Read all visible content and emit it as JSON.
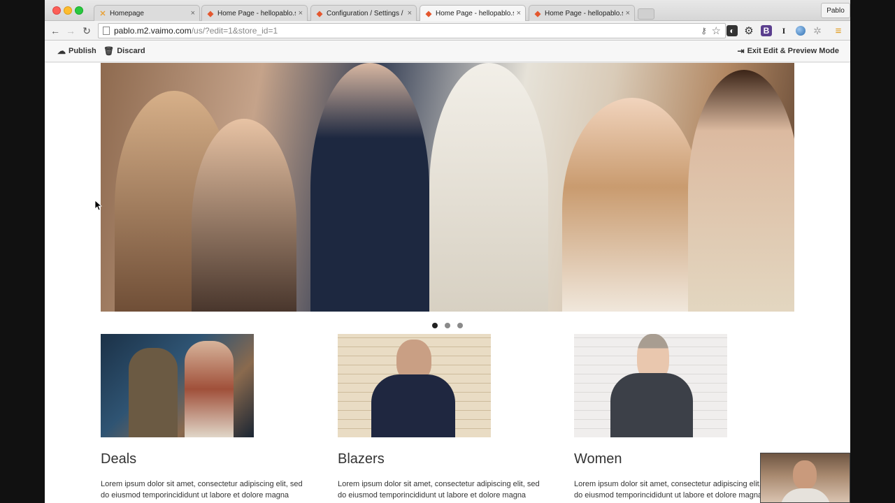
{
  "browser": {
    "tabs": [
      {
        "label": "Homepage",
        "icon": "x-favicon",
        "active": false
      },
      {
        "label": "Home Page - hellopablo.se",
        "icon": "magento-icon",
        "active": false
      },
      {
        "label": "Configuration / Settings / S",
        "icon": "magento-icon",
        "active": false
      },
      {
        "label": "Home Page - hellopablo.se",
        "icon": "magento-icon",
        "active": true
      },
      {
        "label": "Home Page - hellopablo.se",
        "icon": "magento-icon",
        "active": false
      }
    ],
    "profile_name": "Pablo",
    "url_host": "pablo.m2.vaimo.com",
    "url_path": "/us/?edit=1&store_id=1"
  },
  "editbar": {
    "publish_label": "Publish",
    "discard_label": "Discard",
    "exit_label": "Exit Edit & Preview Mode"
  },
  "slider": {
    "dot_count": 3,
    "active_index": 0
  },
  "categories": [
    {
      "title": "Deals",
      "text_line1": "Lorem ipsum dolor sit amet, consectetur adipiscing elit, sed",
      "text_line2": "do eiusmod temporincididunt ut labore et dolore magna"
    },
    {
      "title": "Blazers",
      "text_line1": "Lorem ipsum dolor sit amet, consectetur adipiscing elit, sed",
      "text_line2": "do eiusmod temporincididunt ut labore et dolore magna"
    },
    {
      "title": "Women",
      "text_line1": "Lorem ipsum dolor sit amet, consectetur adipiscing elit, sed",
      "text_line2": "do eiusmod temporincididunt ut labore et dolore magna"
    }
  ],
  "colors": {
    "magento_orange": "#e4572e",
    "active_dot": "#222222",
    "inactive_dot": "#8a8a8a"
  }
}
